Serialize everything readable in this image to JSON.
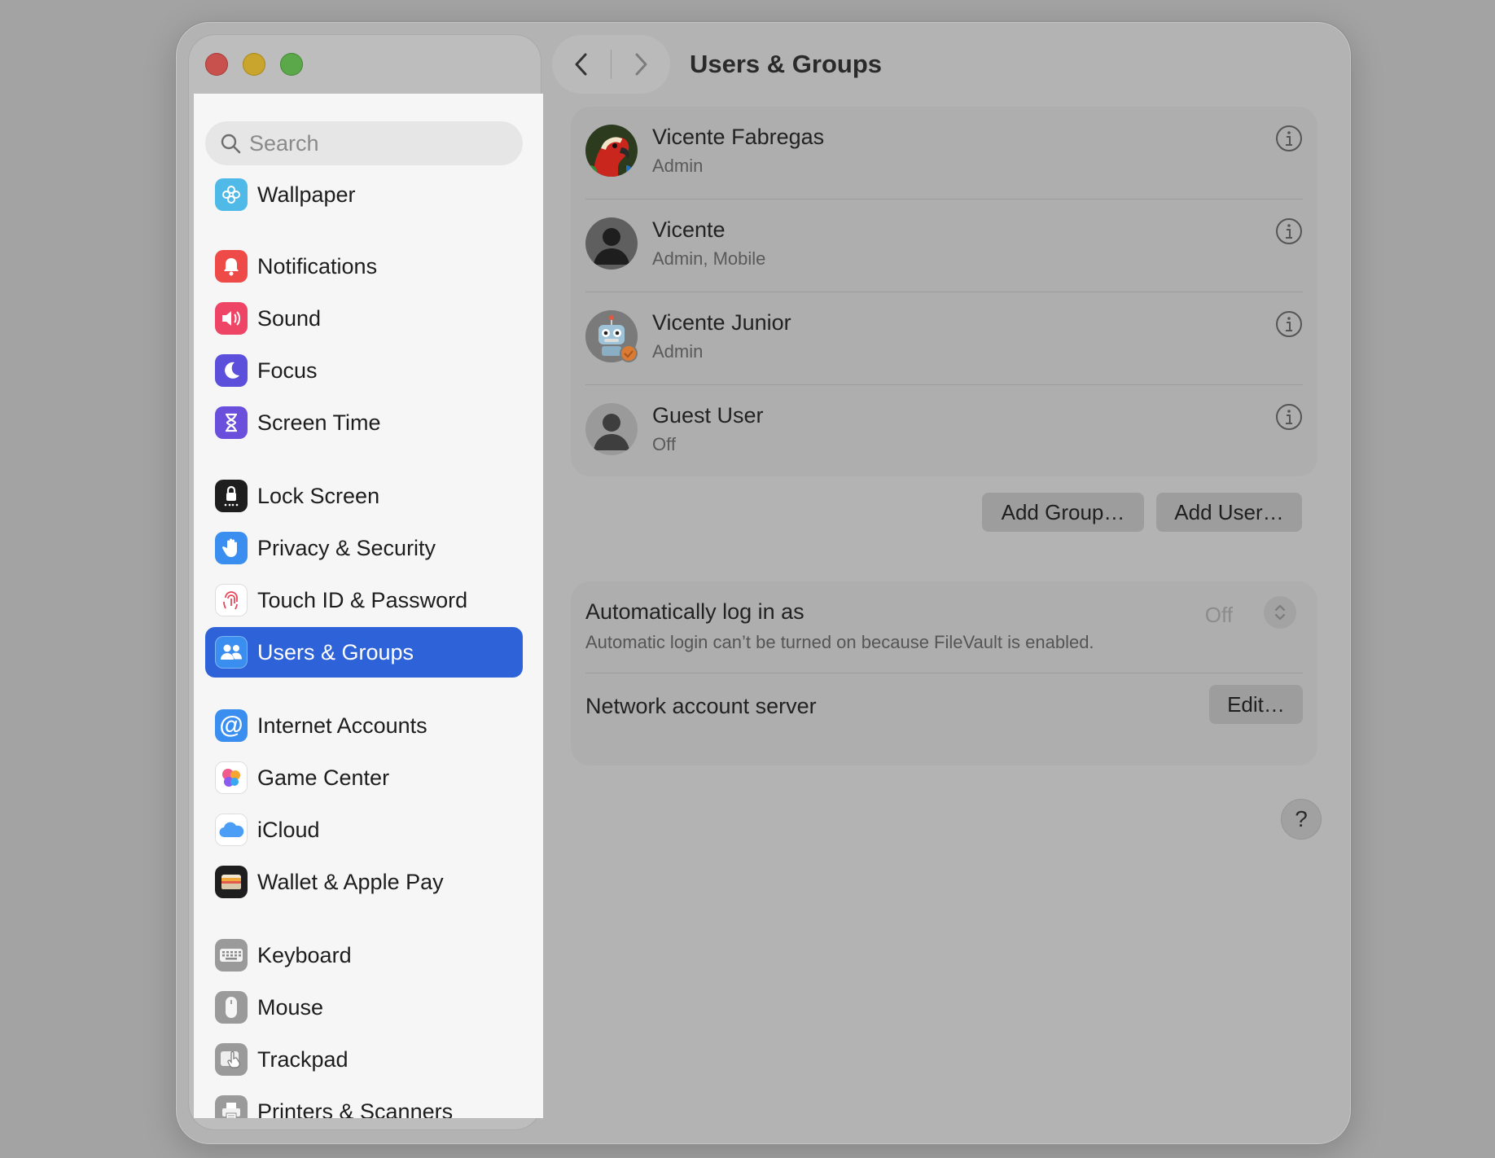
{
  "window": {
    "title": "Users & Groups"
  },
  "search": {
    "placeholder": "Search"
  },
  "sidebar": {
    "items": [
      {
        "label": "Wallpaper",
        "icon": "wallpaper-icon",
        "color": "#4fb9e8"
      },
      {
        "label": "Notifications",
        "icon": "notifications-icon",
        "color": "#ee4a47"
      },
      {
        "label": "Sound",
        "icon": "sound-icon",
        "color": "#ee4466"
      },
      {
        "label": "Focus",
        "icon": "focus-icon",
        "color": "#5b4fdc"
      },
      {
        "label": "Screen Time",
        "icon": "screen-time-icon",
        "color": "#6a4fdc"
      },
      {
        "label": "Lock Screen",
        "icon": "lock-screen-icon",
        "color": "#1e1e1e"
      },
      {
        "label": "Privacy & Security",
        "icon": "privacy-hand-icon",
        "color": "#3a8ef0"
      },
      {
        "label": "Touch ID & Password",
        "icon": "fingerprint-icon",
        "color": "#ffffff"
      },
      {
        "label": "Users & Groups",
        "icon": "users-groups-icon",
        "color": "#3a8ef0",
        "selected": true
      },
      {
        "label": "Internet Accounts",
        "icon": "at-sign-icon",
        "color": "#3a8ef0"
      },
      {
        "label": "Game Center",
        "icon": "game-center-icon",
        "color": "#ffffff"
      },
      {
        "label": "iCloud",
        "icon": "icloud-icon",
        "color": "#ffffff"
      },
      {
        "label": "Wallet & Apple Pay",
        "icon": "wallet-icon",
        "color": "#1e1e1e"
      },
      {
        "label": "Keyboard",
        "icon": "keyboard-icon",
        "color": "#9a9a9a"
      },
      {
        "label": "Mouse",
        "icon": "mouse-icon",
        "color": "#9a9a9a"
      },
      {
        "label": "Trackpad",
        "icon": "trackpad-icon",
        "color": "#9a9a9a"
      },
      {
        "label": "Printers & Scanners",
        "icon": "printer-icon",
        "color": "#9a9a9a"
      }
    ]
  },
  "users": [
    {
      "name": "Vicente Fabregas",
      "role": "Admin",
      "avatar": "parrot-avatar"
    },
    {
      "name": "Vicente",
      "role": "Admin, Mobile",
      "avatar": "generic-person-avatar"
    },
    {
      "name": "Vicente Junior",
      "role": "Admin",
      "avatar": "robot-avatar"
    },
    {
      "name": "Guest User",
      "role": "Off",
      "avatar": "guest-avatar"
    }
  ],
  "actions": {
    "add_group": "Add Group…",
    "add_user": "Add User…"
  },
  "settings": {
    "auto_login_label": "Automatically log in as",
    "auto_login_value": "Off",
    "auto_login_note": "Automatic login can’t be turned on because FileVault is enabled.",
    "network_label": "Network account server",
    "edit_button": "Edit…"
  },
  "help": {
    "label": "?"
  },
  "colors": {
    "accent": "#2e62d9",
    "window_bg": "#b3b3b3",
    "sidebar_bg": "#f6f6f6"
  }
}
